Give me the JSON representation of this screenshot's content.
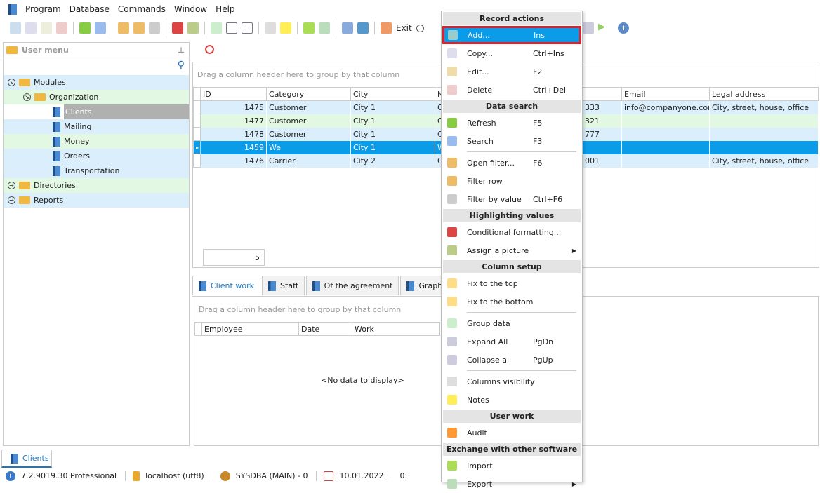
{
  "menubar": [
    "Program",
    "Database",
    "Commands",
    "Window",
    "Help"
  ],
  "toolbar": {
    "exit_label": "Exit"
  },
  "user_menu": {
    "title": "User menu",
    "tree": [
      {
        "label": "Modules",
        "level": 0,
        "type": "folder"
      },
      {
        "label": "Organization",
        "level": 1,
        "type": "folder"
      },
      {
        "label": "Clients",
        "level": 2,
        "type": "book",
        "selected": true
      },
      {
        "label": "Mailing",
        "level": 2,
        "type": "book"
      },
      {
        "label": "Money",
        "level": 2,
        "type": "book"
      },
      {
        "label": "Orders",
        "level": 2,
        "type": "book"
      },
      {
        "label": "Transportation",
        "level": 2,
        "type": "book"
      },
      {
        "label": "Directories",
        "level": 0,
        "type": "folder"
      },
      {
        "label": "Reports",
        "level": 0,
        "type": "folder"
      }
    ]
  },
  "grid": {
    "group_hint": "Drag a column header here to group by that column",
    "columns": [
      "ID",
      "Category",
      "City",
      "N",
      "",
      "Email",
      "Legal address"
    ],
    "rows": [
      [
        "1475",
        "Customer",
        "City 1",
        "C",
        "333",
        "info@companyone.com",
        "City, street, house, office"
      ],
      [
        "1477",
        "Customer",
        "City 1",
        "C",
        "321",
        "",
        ""
      ],
      [
        "1478",
        "Customer",
        "City 1",
        "C",
        "777",
        "",
        ""
      ],
      [
        "1459",
        "We",
        "City 1",
        "W",
        "",
        "",
        ""
      ],
      [
        "1476",
        "Carrier",
        "City 2",
        "C",
        "001",
        "",
        "City, street, house, office"
      ]
    ],
    "selected_row": 3,
    "count": "5"
  },
  "tabs": [
    "Client work",
    "Staff",
    "Of the agreement",
    "Graphics"
  ],
  "subgrid": {
    "group_hint": "Drag a column header here to group by that column",
    "columns": [
      "Employee",
      "Date",
      "Work"
    ],
    "empty": "<No data to display>"
  },
  "context_menu": [
    {
      "header": "Record actions"
    },
    {
      "label": "Add...",
      "key": "Ins",
      "icon": "add-icon",
      "highlighted": true
    },
    {
      "label": "Copy...",
      "key": "Ctrl+Ins",
      "icon": "copy-icon"
    },
    {
      "label": "Edit...",
      "key": "F2",
      "icon": "edit-icon"
    },
    {
      "label": "Delete",
      "key": "Ctrl+Del",
      "icon": "delete-icon"
    },
    {
      "header": "Data search"
    },
    {
      "label": "Refresh",
      "key": "F5",
      "icon": "refresh-icon"
    },
    {
      "label": "Search",
      "key": "F3",
      "icon": "search-icon",
      "sep_after": true
    },
    {
      "label": "Open filter...",
      "key": "F6",
      "icon": "filter-icon"
    },
    {
      "label": "Filter row",
      "key": "",
      "icon": "filter-row-icon"
    },
    {
      "label": "Filter by value",
      "key": "Ctrl+F6",
      "icon": "filter-value-icon"
    },
    {
      "header": "Highlighting values"
    },
    {
      "label": "Conditional formatting...",
      "key": "",
      "icon": "flag-icon"
    },
    {
      "label": "Assign a picture",
      "key": "",
      "icon": "picture-icon",
      "submenu": true
    },
    {
      "header": "Column setup"
    },
    {
      "label": "Fix to the top",
      "key": "",
      "icon": "fix-top-icon"
    },
    {
      "label": "Fix to the bottom",
      "key": "",
      "icon": "fix-bottom-icon",
      "sep_after": true
    },
    {
      "label": "Group data",
      "key": "",
      "icon": "group-icon"
    },
    {
      "label": "Expand All",
      "key": "PgDn",
      "icon": "expand-icon"
    },
    {
      "label": "Collapse all",
      "key": "PgUp",
      "icon": "collapse-icon",
      "sep_after": true
    },
    {
      "label": "Columns visibility",
      "key": "",
      "icon": "columns-icon"
    },
    {
      "label": "Notes",
      "key": "",
      "icon": "notes-icon"
    },
    {
      "header": "User work"
    },
    {
      "label": "Audit",
      "key": "",
      "icon": "audit-icon"
    },
    {
      "header": "Exchange with other software"
    },
    {
      "label": "Import",
      "key": "",
      "icon": "import-icon"
    },
    {
      "label": "Export",
      "key": "",
      "icon": "export-icon",
      "submenu": true
    }
  ],
  "bottom_tab": "Clients",
  "status": {
    "version": "7.2.9019.30 Professional",
    "server": "localhost (utf8)",
    "user": "SYSDBA (MAIN) - 0",
    "date": "10.01.2022",
    "time": "0:"
  }
}
